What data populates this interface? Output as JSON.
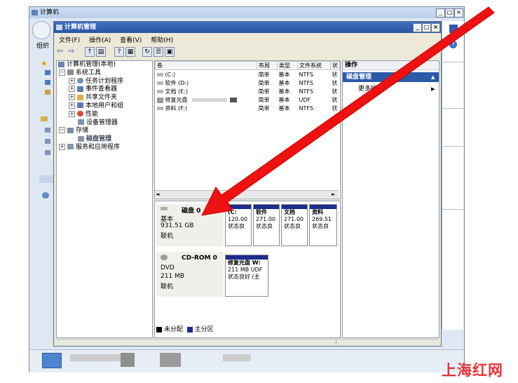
{
  "outer_window": {
    "title": "计算机",
    "left_label": "组织",
    "win_buttons": [
      "_",
      "□",
      "×"
    ]
  },
  "inner_window": {
    "title": "计算机管理",
    "win_buttons": [
      "_",
      "□",
      "×"
    ],
    "menu": [
      "文件(F)",
      "操作(A)",
      "查看(V)",
      "帮助(H)"
    ],
    "tree": [
      {
        "label": "计算机管理(本地)",
        "expander": "",
        "indent": 0
      },
      {
        "label": "系统工具",
        "expander": "−",
        "indent": 1
      },
      {
        "label": "任务计划程序",
        "expander": "+",
        "indent": 2
      },
      {
        "label": "事件查看器",
        "expander": "+",
        "indent": 2
      },
      {
        "label": "共享文件夹",
        "expander": "+",
        "indent": 2
      },
      {
        "label": "本地用户和组",
        "expander": "+",
        "indent": 2
      },
      {
        "label": "性能",
        "expander": "+",
        "indent": 2
      },
      {
        "label": "设备管理器",
        "expander": "",
        "indent": 2
      },
      {
        "label": "存储",
        "expander": "−",
        "indent": 1
      },
      {
        "label": "磁盘管理",
        "expander": "",
        "indent": 2
      },
      {
        "label": "服务和应用程序",
        "expander": "+",
        "indent": 1
      }
    ],
    "volume_table": {
      "headers": [
        "卷",
        "布局",
        "类型",
        "文件系统",
        "状"
      ],
      "rows": [
        [
          "(C:)",
          "简单",
          "基本",
          "NTFS",
          "状"
        ],
        [
          "软件 (D:)",
          "简单",
          "基本",
          "NTFS",
          "状"
        ],
        [
          "文档 (E:)",
          "简单",
          "基本",
          "NTFS",
          "状"
        ],
        [
          "修复光盘",
          "简单",
          "基本",
          "UDF",
          "状"
        ],
        [
          "资料 (F:)",
          "简单",
          "基本",
          "NTFS",
          "状"
        ]
      ]
    },
    "disks": [
      {
        "name": "磁盘 0",
        "type": "基本",
        "size": "931.51 GB",
        "status": "联机",
        "partitions": [
          {
            "name": "(C:",
            "size": "120.00",
            "status": "状态良"
          },
          {
            "name": "软件",
            "size": "271.00",
            "status": "状态良"
          },
          {
            "name": "文档",
            "size": "271.00",
            "status": "状态良"
          },
          {
            "name": "资料",
            "size": "269.51",
            "status": "状态良"
          }
        ]
      },
      {
        "name": "CD-ROM 0",
        "type": "DVD",
        "size": "211 MB",
        "status": "联机",
        "partitions": [
          {
            "name": "修复光盘 W:",
            "size": "211 MB UDF",
            "status": "状态良好 (主"
          }
        ]
      }
    ],
    "legend": [
      "未分配",
      "主分区"
    ],
    "actions": {
      "header": "操作",
      "section": "磁盘管理",
      "more": "更多操作"
    }
  },
  "watermark": "上海红网",
  "colors": {
    "arrow": "#ee1111",
    "partition_bar": "#1c2d8c",
    "legend_unallocated": "#000000",
    "legend_primary": "#1c2d8c",
    "watermark": "#e8343a"
  }
}
